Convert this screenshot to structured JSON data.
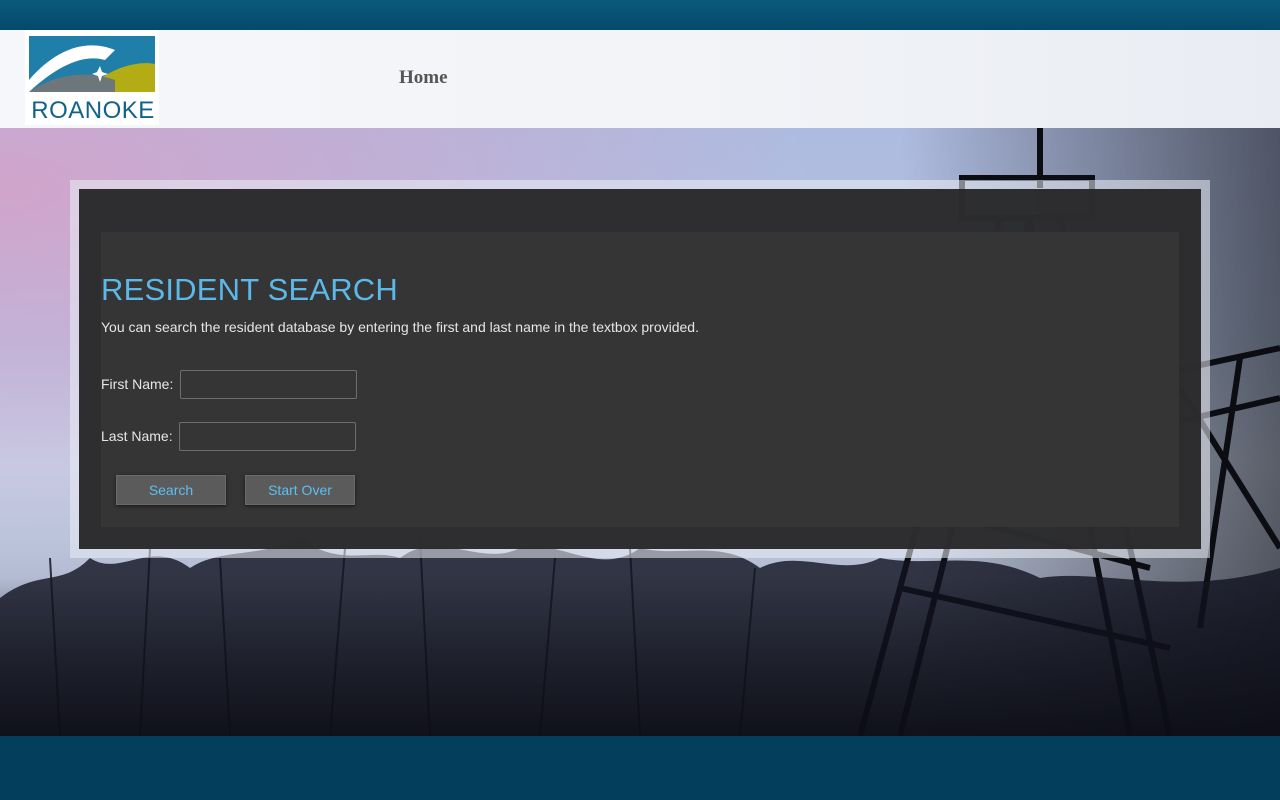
{
  "header": {
    "logo_text": "ROANOKE",
    "nav": {
      "home_label": "Home"
    }
  },
  "colors": {
    "header_strip": "#044a6b",
    "footer": "#033f5c",
    "title": "#5bb8e8",
    "button_text": "#5bc0f0",
    "logo_text": "#11628a",
    "logo_yellow": "#b4ac15",
    "logo_gray": "#6c767b"
  },
  "icons": {
    "logo": "roanoke-city-logo"
  },
  "main": {
    "title": "RESIDENT SEARCH",
    "description": "You can search the resident database by entering the first and last name in the textbox provided.",
    "form": {
      "first_name_label": "First Name:",
      "first_name_value": "",
      "last_name_label": "Last Name:",
      "last_name_value": "",
      "search_label": "Search",
      "start_over_label": "Start Over"
    }
  }
}
